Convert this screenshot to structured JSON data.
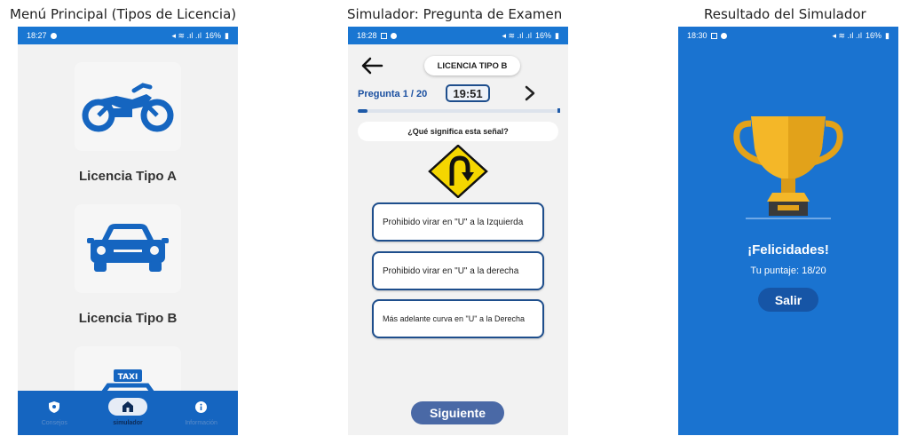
{
  "captions": {
    "menu": "Menú Principal (Tipos de Licencia)",
    "exam": "Simulador: Pregunta de Examen",
    "result": "Resultado del Simulador"
  },
  "menu_screen": {
    "status": {
      "time": "18:27",
      "battery": "16%"
    },
    "licenses": [
      {
        "label": "Licencia Tipo A",
        "icon": "motorcycle-icon"
      },
      {
        "label": "Licencia Tipo B",
        "icon": "car-icon"
      },
      {
        "label": "",
        "icon": "taxi-icon",
        "badge": "TAXI"
      }
    ],
    "nav": [
      {
        "label": "Consejos",
        "icon": "shield-icon"
      },
      {
        "label": "simulador",
        "icon": "home-icon"
      },
      {
        "label": "Información",
        "icon": "info-icon"
      }
    ],
    "colors": {
      "accent": "#1565c0",
      "icon": "#1565c0"
    }
  },
  "exam_screen": {
    "status": {
      "time": "18:28",
      "battery": "16%"
    },
    "license_chip": "LICENCIA TIPO B",
    "question_counter": "Pregunta 1 / 20",
    "timer": "19:51",
    "progress_fraction": 0.05,
    "question": "¿Qué significa esta señal?",
    "sign_icon": "u-turn-sign-icon",
    "options": [
      "Prohibido virar en \"U\" a la Izquierda",
      "Prohibido virar en \"U\" a la derecha",
      "Más adelante curva en \"U\" a la Derecha"
    ],
    "next_label": "Siguiente"
  },
  "result_screen": {
    "status": {
      "time": "18:30",
      "battery": "16%"
    },
    "trophy_icon": "trophy-icon",
    "title": "¡Felicidades!",
    "score": "Tu puntaje: 18/20",
    "exit_label": "Salir",
    "colors": {
      "background": "#1a73d0"
    }
  }
}
